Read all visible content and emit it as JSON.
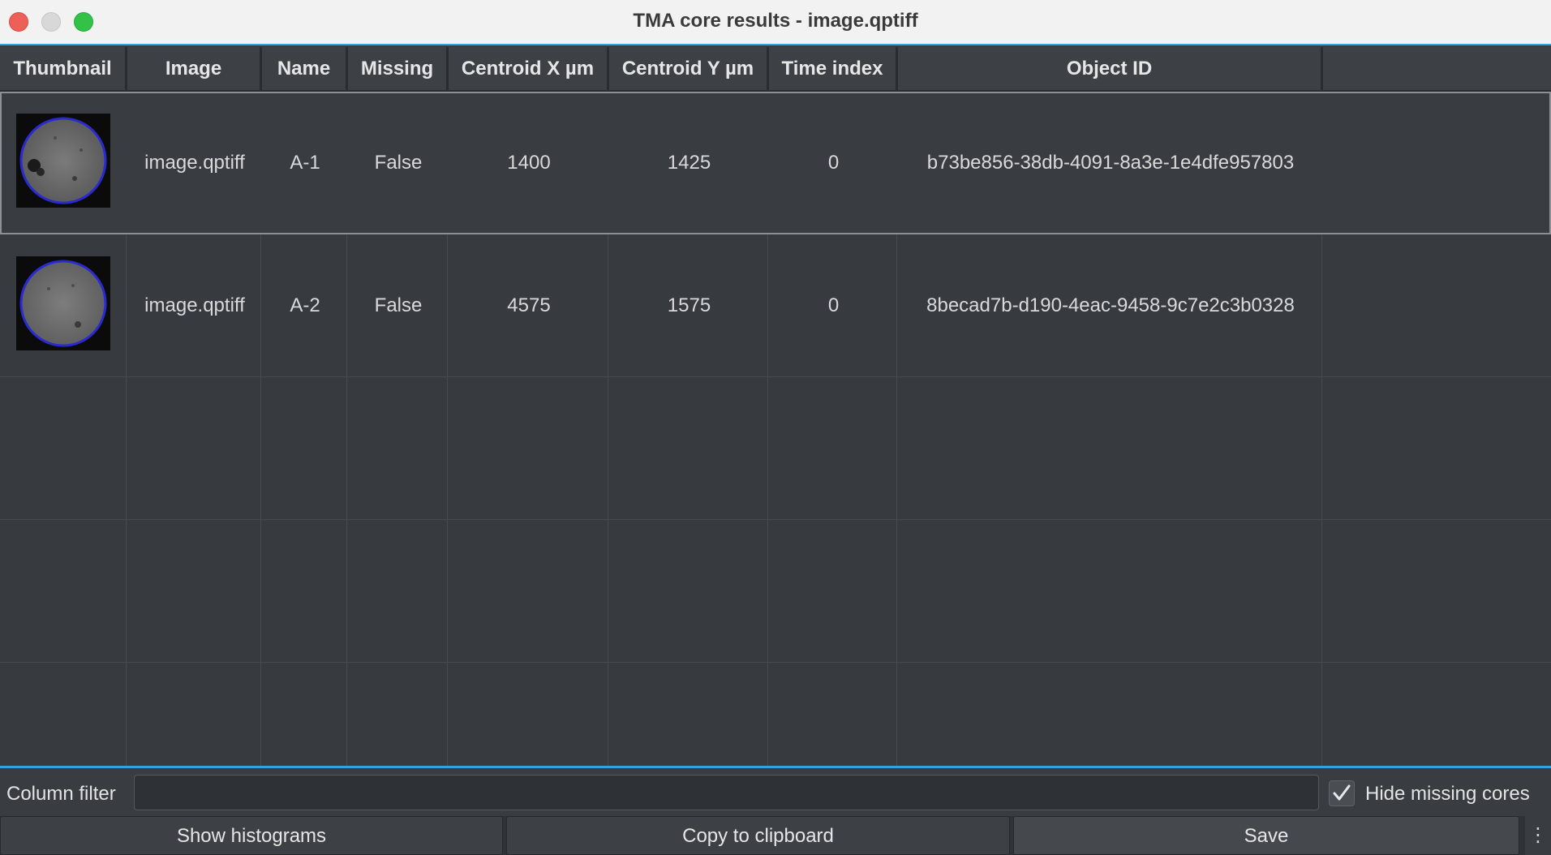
{
  "window": {
    "title": "TMA core results - image.qptiff"
  },
  "table": {
    "columns": [
      "Thumbnail",
      "Image",
      "Name",
      "Missing",
      "Centroid X µm",
      "Centroid Y µm",
      "Time index",
      "Object ID",
      ""
    ],
    "rows": [
      {
        "thumbnail": "tissue-core-thumbnail",
        "image": "image.qptiff",
        "name": "A-1",
        "missing": "False",
        "centroid_x": "1400",
        "centroid_y": "1425",
        "time_index": "0",
        "object_id": "b73be856-38db-4091-8a3e-1e4dfe957803",
        "selected": true
      },
      {
        "thumbnail": "tissue-core-thumbnail",
        "image": "image.qptiff",
        "name": "A-2",
        "missing": "False",
        "centroid_x": "4575",
        "centroid_y": "1575",
        "time_index": "0",
        "object_id": "8becad7b-d190-4eac-9458-9c7e2c3b0328",
        "selected": false
      }
    ]
  },
  "filter": {
    "label": "Column filter",
    "value": "",
    "hide_missing_label": "Hide missing cores",
    "hide_missing_checked": true
  },
  "buttons": {
    "histograms": "Show histograms",
    "clipboard": "Copy to clipboard",
    "save": "Save",
    "more": "⋮"
  },
  "colors": {
    "accent": "#2fa4d6",
    "core_outline": "#2a2ad0",
    "close": "#ee5f58",
    "minimize": "#d9d8d8",
    "maximize": "#33c247"
  }
}
